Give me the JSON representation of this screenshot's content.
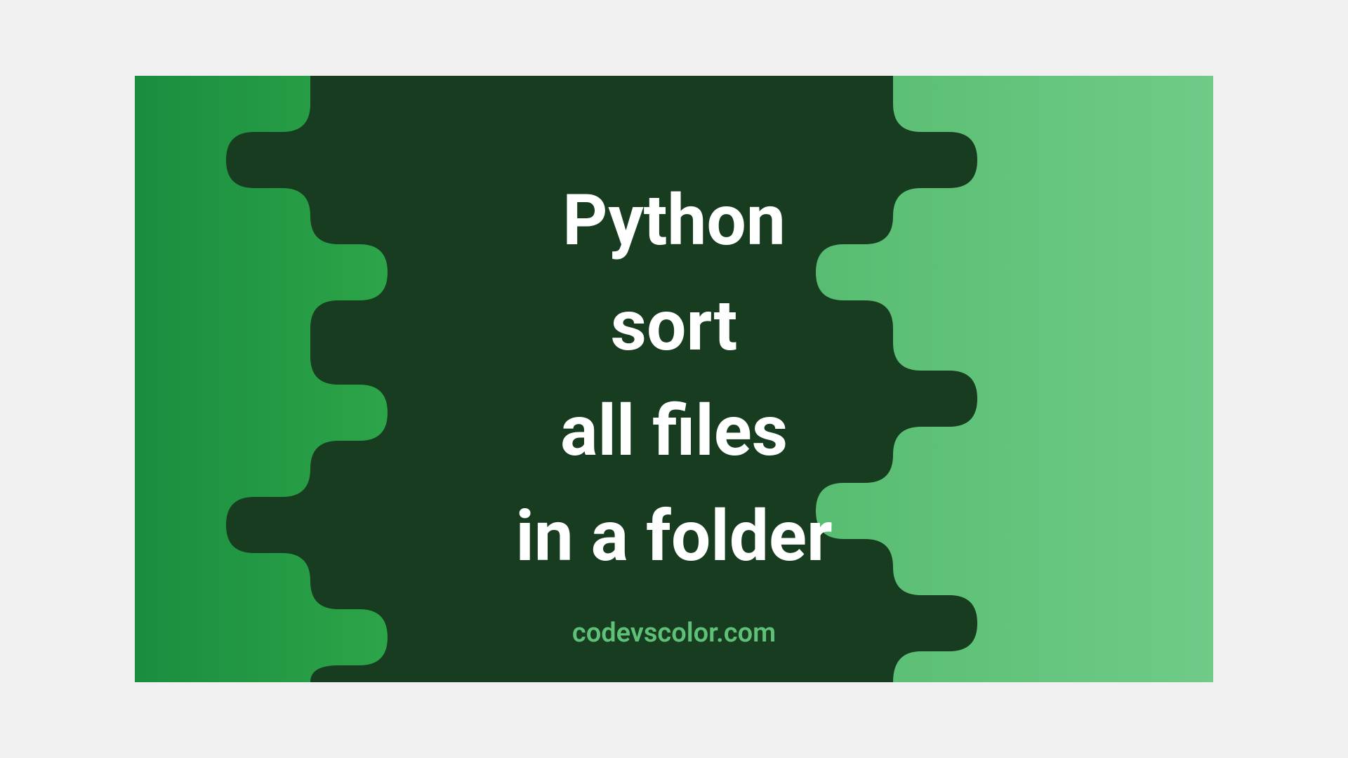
{
  "title": {
    "line1": "Python",
    "line2": "sort",
    "line3": "all files",
    "line4": "in a folder"
  },
  "footer": "codevscolor.com",
  "colors": {
    "darkGreen": "#183c1f",
    "gradientStart": "#1a8d3f",
    "gradientEnd": "#6fcb87",
    "textWhite": "#ffffff",
    "footerGreen": "#5fc178"
  }
}
